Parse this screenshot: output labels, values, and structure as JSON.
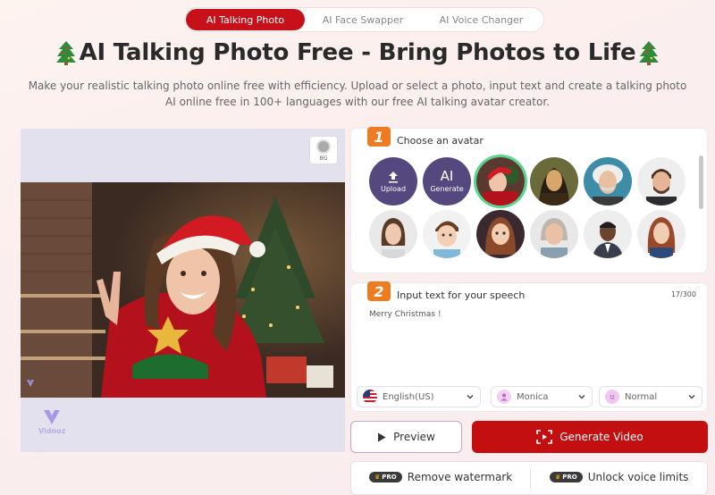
{
  "tabs": [
    {
      "label": "AI Talking Photo",
      "active": true
    },
    {
      "label": "AI Face Swapper",
      "active": false
    },
    {
      "label": "AI Voice Changer",
      "active": false
    }
  ],
  "title": "AI Talking Photo Free - Bring Photos to Life",
  "subtitle_line1": "Make your realistic talking photo online free with efficiency. Upload or select a photo, input text and create a talking photo",
  "subtitle_line2": "AI online free in 100+ languages with our free AI talking avatar creator.",
  "preview": {
    "bg_label": "BG",
    "watermark": "Vidnoz"
  },
  "step1": {
    "number": "1",
    "label": "Choose an avatar",
    "upload_label": "Upload",
    "generate_icon": "AI",
    "generate_label": "Generate"
  },
  "step2": {
    "number": "2",
    "label": "Input text for your speech",
    "counter": "17/300",
    "text": "Merry Christmas !"
  },
  "language": {
    "value": "English(US)",
    "icon": "us-flag-icon"
  },
  "voice": {
    "value": "Monica",
    "icon": "female-voice-icon"
  },
  "style": {
    "value": "Normal",
    "icon": "smile-icon"
  },
  "buttons": {
    "preview": "Preview",
    "generate": "Generate Video"
  },
  "pro": {
    "badge": "PRO",
    "remove_watermark": "Remove watermark",
    "unlock_voice": "Unlock voice limits"
  },
  "colors": {
    "accent_red": "#c40f10",
    "step_orange": "#ee7b20",
    "avatar_purple": "#54487e",
    "selected_green": "#55d68a"
  }
}
